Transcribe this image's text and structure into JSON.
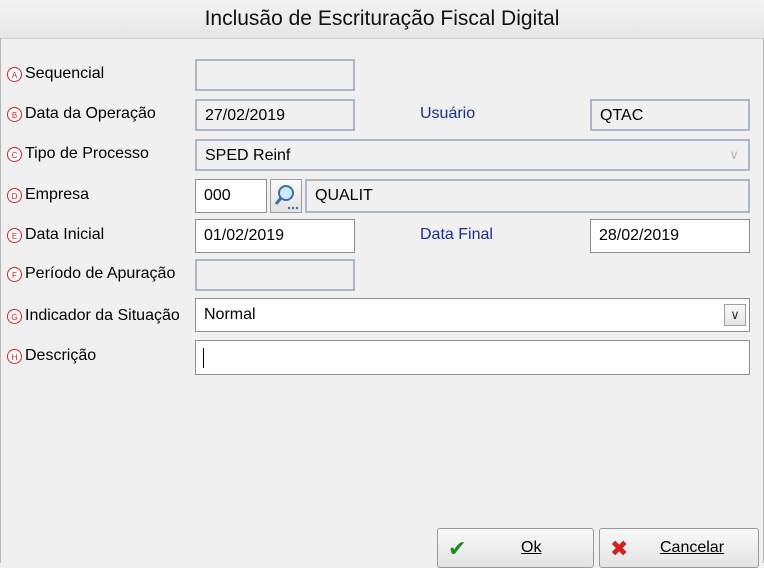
{
  "window": {
    "title": "Inclusão de Escrituração Fiscal Digital"
  },
  "form": {
    "sequencial": {
      "marker": "A",
      "label": "Sequencial",
      "value": ""
    },
    "data_operacao": {
      "marker": "B",
      "label": "Data da Operação",
      "value": "27/02/2019"
    },
    "usuario": {
      "label": "Usuário",
      "value": "QTAC"
    },
    "tipo_processo": {
      "marker": "C",
      "label": "Tipo de Processo",
      "value": "SPED Reinf"
    },
    "empresa": {
      "marker": "D",
      "label": "Empresa",
      "code": "000",
      "name": "QUALIT"
    },
    "data_inicial": {
      "marker": "E",
      "label": "Data Inicial",
      "value": "01/02/2019"
    },
    "data_final": {
      "label": "Data Final",
      "value": "28/02/2019"
    },
    "periodo_apuracao": {
      "marker": "F",
      "label": "Período de Apuração",
      "value": ""
    },
    "indicador_situacao": {
      "marker": "G",
      "label": "Indicador da Situação",
      "value": "Normal"
    },
    "descricao": {
      "marker": "H",
      "label": "Descrição",
      "value": ""
    }
  },
  "buttons": {
    "ok": {
      "label": "Ok",
      "icon": "check-icon"
    },
    "cancel": {
      "label": "Cancelar",
      "icon": "x-icon"
    }
  },
  "colors": {
    "marker": "#d02020",
    "ok_icon": "#1f8a1f",
    "cancel_icon": "#d02020"
  }
}
